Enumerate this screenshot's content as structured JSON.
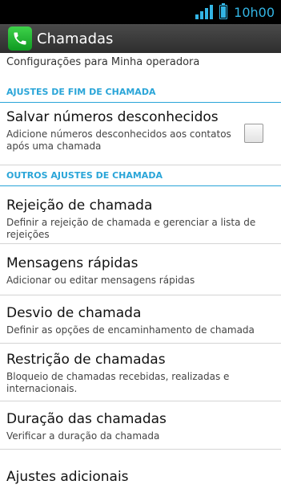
{
  "status_bar": {
    "time": "10h00"
  },
  "action_bar": {
    "title": "Chamadas",
    "icon": "phone-icon"
  },
  "partial_item": {
    "summary": "Configurações para Minha operadora"
  },
  "sections": [
    {
      "header": "AJUSTES DE FIM DE CHAMADA",
      "items": [
        {
          "title": "Salvar números desconhecidos",
          "summary": "Adicione números desconhecidos aos contatos após uma chamada",
          "checked": false
        }
      ]
    },
    {
      "header": "OUTROS AJUSTES DE CHAMADA",
      "items": [
        {
          "title": "Rejeição de chamada",
          "summary": "Definir a rejeição de chamada e gerenciar a lista de rejeições"
        },
        {
          "title": "Mensagens rápidas",
          "summary": "Adicionar ou editar mensagens rápidas"
        },
        {
          "title": "Desvio de chamada",
          "summary": "Definir as opções de encaminhamento de chamada"
        },
        {
          "title": "Restrição de chamadas",
          "summary": "Bloqueio de chamadas recebidas, realizadas e internacionais."
        },
        {
          "title": "Duração das chamadas",
          "summary": "Verificar a duração da chamada"
        },
        {
          "title": "Ajustes adicionais"
        }
      ]
    }
  ],
  "colors": {
    "accent": "#33b5e5",
    "section_header": "#2aa5d8",
    "action_bar": "#3a3a3a"
  }
}
